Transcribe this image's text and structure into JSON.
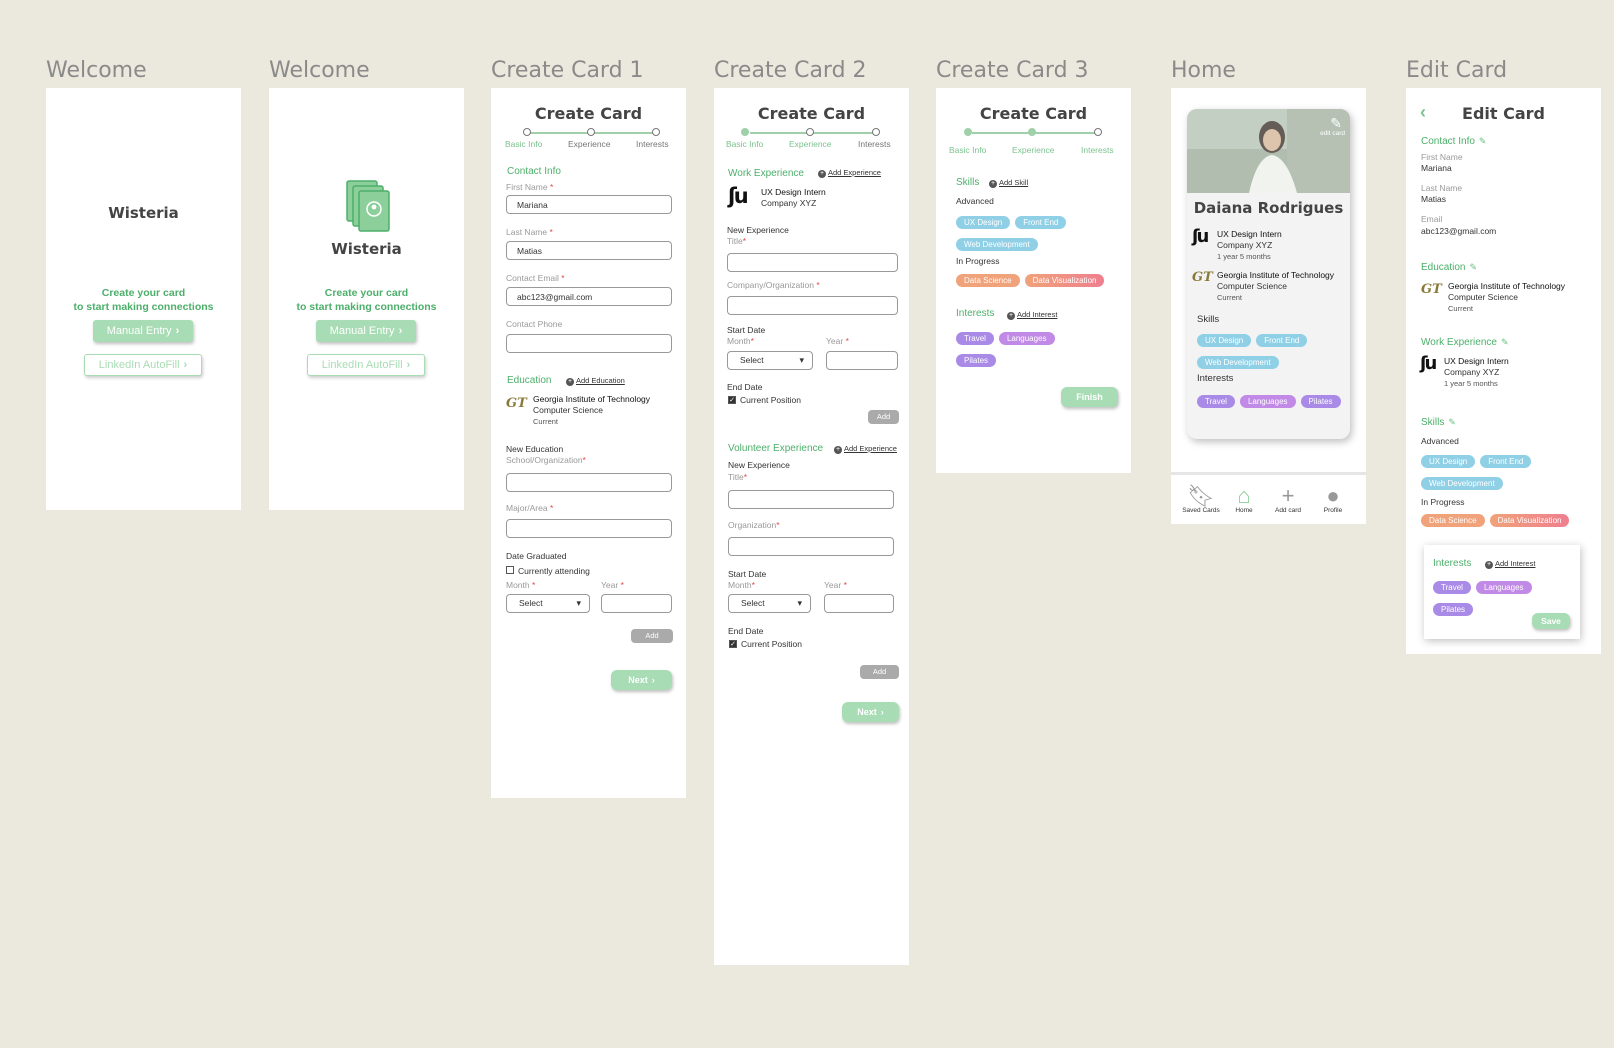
{
  "frames": {
    "welcome1": "Welcome",
    "welcome2": "Welcome",
    "create1": "Create Card 1",
    "create2": "Create Card 2",
    "create3": "Create Card 3",
    "home": "Home",
    "edit": "Edit Card"
  },
  "welcome": {
    "brand": "Wisteria",
    "tagline_1": "Create your card",
    "tagline_2": "to start making connections",
    "manual_entry": "Manual Entry",
    "linkedin_autofill": "LinkedIn AutoFill"
  },
  "create_card": {
    "title": "Create Card",
    "steps": [
      "Basic Info",
      "Experience",
      "Interests"
    ],
    "next": "Next",
    "add": "Add",
    "finish": "Finish"
  },
  "create1": {
    "contact_info": "Contact Info",
    "first_name_label": "First Name",
    "first_name_value": "Mariana",
    "last_name_label": "Last Name",
    "last_name_value": "Matias",
    "email_label": "Contact Email",
    "email_value": "abc123@gmail.com",
    "phone_label": "Contact Phone",
    "education": "Education",
    "add_education": "Add Education",
    "school": "Georgia Institute of Technology",
    "major": "Computer Science",
    "status": "Current",
    "new_education": "New Education",
    "school_label": "School/Organization",
    "major_label": "Major/Area",
    "date_graduated": "Date Graduated",
    "currently_attending": "Currently attending",
    "month_label": "Month",
    "year_label": "Year",
    "select": "Select"
  },
  "create2": {
    "work_experience": "Work Experience",
    "add_experience": "Add Experience",
    "job_title": "UX Design Intern",
    "company": "Company XYZ",
    "new_experience": "New Experience",
    "title_label": "Title",
    "company_label": "Company/Organization",
    "start_date": "Start Date",
    "month_label": "Month",
    "year_label": "Year",
    "select": "Select",
    "end_date": "End Date",
    "current_position": "Current Position",
    "volunteer_experience": "Volunteer Experience",
    "org_label": "Organization"
  },
  "create3": {
    "skills": "Skills",
    "add_skill": "Add Skill",
    "advanced": "Advanced",
    "advanced_tags": [
      "UX Design",
      "Front End",
      "Web Development"
    ],
    "in_progress": "In Progress",
    "progress_tags": [
      "Data Science",
      "Data Visualization"
    ],
    "interests": "Interests",
    "add_interest": "Add Interest",
    "interest_tags": [
      "Travel",
      "Languages",
      "Pilates"
    ]
  },
  "home": {
    "edit_card": "edit card",
    "name": "Daiana Rodrigues",
    "job_title": "UX Design Intern",
    "company": "Company XYZ",
    "duration": "1 year 5 months",
    "school": "Georgia Institute of Technology",
    "major": "Computer Science",
    "status": "Current",
    "skills": "Skills",
    "interests": "Interests",
    "nav": [
      "Saved Cards",
      "Home",
      "Add card",
      "Profile"
    ]
  },
  "edit": {
    "title": "Edit Card",
    "contact_info": "Contact Info",
    "first_name_label": "First Name",
    "first_name_value": "Mariana",
    "last_name_label": "Last Name",
    "last_name_value": "Matias",
    "email_label": "Email",
    "email_value": "abc123@gmail.com",
    "education": "Education",
    "work_experience": "Work Experience",
    "skills": "Skills",
    "advanced": "Advanced",
    "in_progress": "In Progress",
    "interests": "Interests",
    "add_interest": "Add Interest",
    "save": "Save"
  },
  "colors": {
    "accent_green": "#4caf6a",
    "button_green": "#a8dcb4",
    "skill_blue": "#8fd0e6",
    "progress_orange": "#f0a27a",
    "progress_red": "#ef8e8e",
    "interest_purple": "#a98ae6"
  }
}
